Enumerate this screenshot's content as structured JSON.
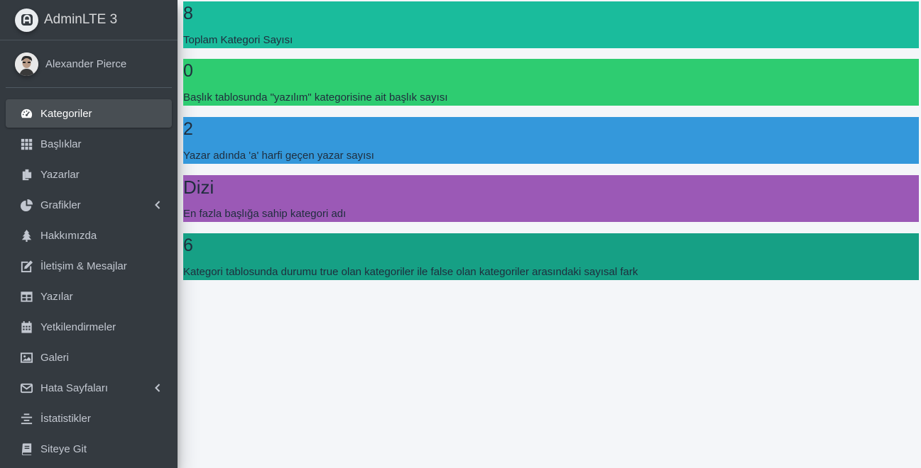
{
  "brand": {
    "title": "AdminLTE 3"
  },
  "user": {
    "name": "Alexander Pierce"
  },
  "sidebar": {
    "items": [
      {
        "label": "Kategoriler",
        "icon": "dashboard-icon",
        "active": true
      },
      {
        "label": "Başlıklar",
        "icon": "grid-icon"
      },
      {
        "label": "Yazarlar",
        "icon": "copy-icon"
      },
      {
        "label": "Grafikler",
        "icon": "pie-chart-icon",
        "has_submenu": true
      },
      {
        "label": "Hakkımızda",
        "icon": "tree-icon"
      },
      {
        "label": "İletişim & Mesajlar",
        "icon": "edit-icon"
      },
      {
        "label": "Yazılar",
        "icon": "table-icon"
      },
      {
        "label": "Yetkilendirmeler",
        "icon": "calendar-icon"
      },
      {
        "label": "Galeri",
        "icon": "image-icon"
      },
      {
        "label": "Hata Sayfaları",
        "icon": "envelope-icon",
        "has_submenu": true
      },
      {
        "label": "İstatistikler",
        "icon": "align-center-icon"
      },
      {
        "label": "Siteye Git",
        "icon": "book-icon"
      }
    ]
  },
  "stats": [
    {
      "value": "8",
      "label": "Toplam Kategori Sayısı",
      "color": "#1abc9c"
    },
    {
      "value": "0",
      "label": "Başlık tablosunda \"yazılım\" kategorisine ait başlık sayısı",
      "color": "#2ecc71"
    },
    {
      "value": "2",
      "label": "Yazar adında 'a' harfi geçen yazar sayısı",
      "color": "#3498db"
    },
    {
      "value": "Dizi",
      "label": "En fazla başlığa sahip kategori adı",
      "color": "#9b59b6"
    },
    {
      "value": "6",
      "label": "Kategori tablosunda durumu true olan kategoriler ile false olan kategoriler arasındaki sayısal fark",
      "color": "#16a085"
    }
  ]
}
